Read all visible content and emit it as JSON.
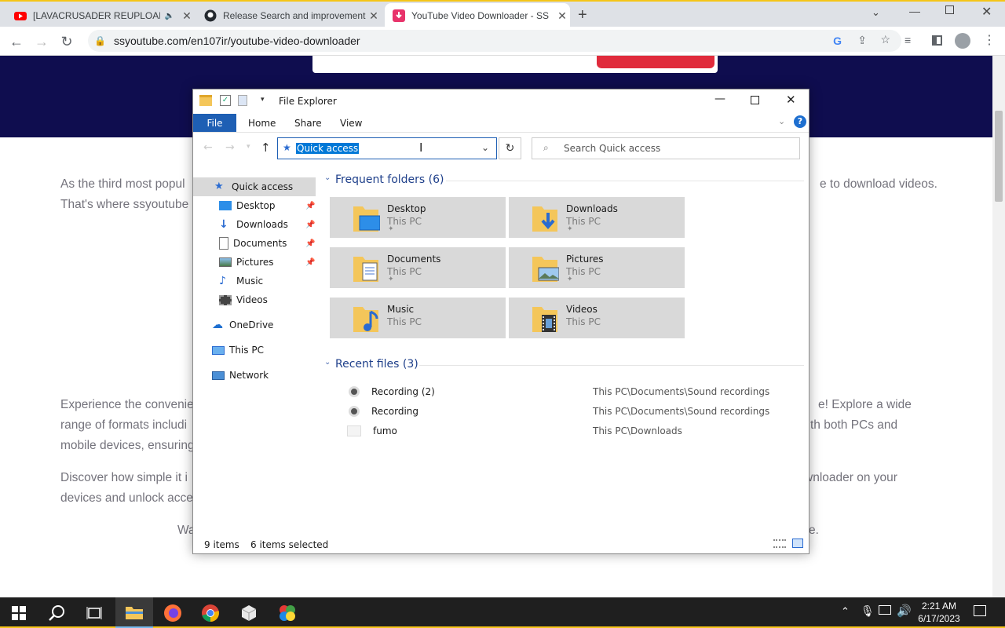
{
  "browser": {
    "tabs": [
      {
        "title": "[LAVACRUSADER REUPLOAD",
        "active": false
      },
      {
        "title": "Release Search and improvement",
        "active": false
      },
      {
        "title": "YouTube Video Downloader - SS",
        "active": true
      }
    ],
    "url": "ssyoutube.com/en107ir/youtube-video-downloader"
  },
  "page": {
    "para1_a": "As the third most popul",
    "para1_b": "That's where ssyoutube",
    "para1_right": "e to download videos.",
    "para2_a": "Experience the convenie",
    "para2_b": "range of formats includi",
    "para2_c": "mobile devices, ensuring",
    "para2_r1": "e! Explore a wide",
    "para2_r2": "th both PCs and",
    "para3_a": "Discover how simple it i",
    "para3_b": "devices and unlock acce",
    "para3_r1": "wnloader on your",
    "para4_a": "Wa",
    "para4_r": "e."
  },
  "explorer": {
    "title": "File Explorer",
    "ribbon": {
      "file": "File",
      "home": "Home",
      "share": "Share",
      "view": "View"
    },
    "address": "Quick access",
    "search_placeholder": "Search Quick access",
    "nav": [
      {
        "label": "Quick access",
        "icon": "star-icon"
      },
      {
        "label": "Desktop",
        "icon": "desktop-icon",
        "pinned": true
      },
      {
        "label": "Downloads",
        "icon": "download-icon",
        "pinned": true
      },
      {
        "label": "Documents",
        "icon": "document-icon",
        "pinned": true
      },
      {
        "label": "Pictures",
        "icon": "picture-icon",
        "pinned": true
      },
      {
        "label": "Music",
        "icon": "music-icon"
      },
      {
        "label": "Videos",
        "icon": "video-icon"
      },
      {
        "label": "OneDrive",
        "icon": "cloud-icon"
      },
      {
        "label": "This PC",
        "icon": "computer-icon"
      },
      {
        "label": "Network",
        "icon": "network-icon"
      }
    ],
    "frequent_header": "Frequent folders (6)",
    "folders": [
      {
        "name": "Desktop",
        "sub": "This PC"
      },
      {
        "name": "Downloads",
        "sub": "This PC"
      },
      {
        "name": "Documents",
        "sub": "This PC"
      },
      {
        "name": "Pictures",
        "sub": "This PC"
      },
      {
        "name": "Music",
        "sub": "This PC"
      },
      {
        "name": "Videos",
        "sub": "This PC"
      }
    ],
    "recent_header": "Recent files (3)",
    "recent": [
      {
        "name": "Recording (2)",
        "path": "This PC\\Documents\\Sound recordings"
      },
      {
        "name": "Recording",
        "path": "This PC\\Documents\\Sound recordings"
      },
      {
        "name": "fumo",
        "path": "This PC\\Downloads"
      }
    ],
    "status": {
      "items": "9 items",
      "selected": "6 items selected"
    }
  },
  "taskbar": {
    "time": "2:21 AM",
    "date": "6/17/2023"
  },
  "colors": {
    "hero": "#0f0d4f",
    "accent_red": "#e02b3c",
    "explorer_blue": "#1e5fb4",
    "tile": "#d9d9d9"
  }
}
